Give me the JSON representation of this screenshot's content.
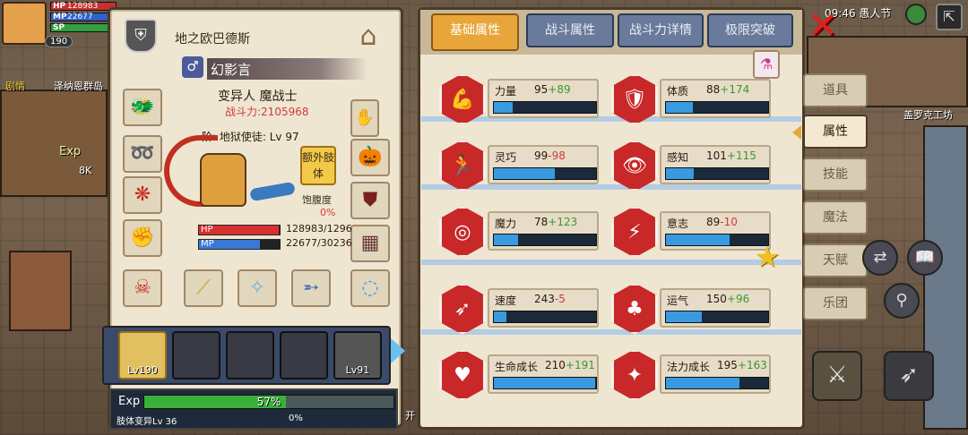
{
  "hud": {
    "hp_label": "HP",
    "hp_value": "128983",
    "mp_label": "MP",
    "mp_value": "22677",
    "sp_label": "SP",
    "level": "190",
    "avatar_icon": "hero-portrait"
  },
  "world": {
    "label_left_top": "剧情",
    "label_left_mid": "泽纳恩群岛",
    "exp_label": "Exp",
    "exp_value": "8K",
    "clock_text": "09:46 愚人节",
    "location": "盖罗克工坊",
    "side_text": "开"
  },
  "char_panel": {
    "title": "地之欧巴德斯",
    "name": "幻影言",
    "class": "变异人 魔战士",
    "power": "战斗力:2105968",
    "job": "阶: 地狱使徒: Lv 97",
    "extra_body": "额外肢体",
    "satiety_label": "饱腹度",
    "satiety_value": "0%",
    "hp_label": "HP",
    "hp_text": "128983/1296",
    "mp_label": "MP",
    "mp_text": "22677/30236",
    "hp_ratio": 0.99,
    "mp_ratio": 0.75,
    "icons": {
      "emblem": "shield-wings-icon",
      "hanger": "hanger-icon",
      "gender": "male-icon",
      "head": "dragon-helmet",
      "neck": "serpent-necklace",
      "body": "phoenix-armor",
      "hands": "demon-gauntlet",
      "belt": "demon-mask",
      "right_top": "blue-gauntlet",
      "right_2": "pumpkin-head",
      "right_3": "spiked-shield",
      "right_4": "dark-armor",
      "right_5": "blue-serpent-ring",
      "weapon1": "golden-staff",
      "weapon2": "ice-blade",
      "weapon3": "swordfish"
    }
  },
  "party": {
    "slots": [
      {
        "level": "Lv190",
        "active": true
      },
      {
        "level": "",
        "active": false
      },
      {
        "level": "",
        "active": false
      },
      {
        "level": "",
        "active": false
      },
      {
        "level": "Lv91",
        "active": false
      }
    ]
  },
  "exp": {
    "label": "Exp",
    "percent": "57%",
    "ratio": 0.57,
    "body_change": "肢体变异Lv 36",
    "body_change_pct": "0%"
  },
  "tabs": [
    {
      "label": "基础属性",
      "active": true
    },
    {
      "label": "战斗属性",
      "active": false
    },
    {
      "label": "战斗力详情",
      "active": false
    },
    {
      "label": "极限突破",
      "active": false
    }
  ],
  "side_menu": [
    {
      "label": "道具",
      "active": false
    },
    {
      "label": "属性",
      "active": true
    },
    {
      "label": "技能",
      "active": false
    },
    {
      "label": "魔法",
      "active": false
    },
    {
      "label": "天赋",
      "active": false
    },
    {
      "label": "乐团",
      "active": false
    }
  ],
  "attributes": [
    {
      "name": "力量",
      "base": "95",
      "mod": "+89",
      "sign": "bonus",
      "icon": "muscle-arm-icon",
      "glyph": "💪",
      "ratio": 0.18
    },
    {
      "name": "体质",
      "base": "88",
      "mod": "+174",
      "sign": "bonus",
      "icon": "body-armor-icon",
      "glyph": "🛡",
      "ratio": 0.26
    },
    {
      "name": "灵巧",
      "base": "99",
      "mod": "-98",
      "sign": "malus",
      "icon": "running-man-icon",
      "glyph": "🏃",
      "ratio": 0.6
    },
    {
      "name": "感知",
      "base": "101",
      "mod": "+115",
      "sign": "bonus",
      "icon": "eye-icon",
      "glyph": "👁",
      "ratio": 0.27
    },
    {
      "name": "魔力",
      "base": "78",
      "mod": "+123",
      "sign": "bonus",
      "icon": "magic-swirl-icon",
      "glyph": "◎",
      "ratio": 0.24
    },
    {
      "name": "意志",
      "base": "89",
      "mod": "-10",
      "sign": "malus",
      "icon": "will-head-icon",
      "glyph": "⚡",
      "ratio": 0.62
    },
    {
      "name": "速度",
      "base": "243",
      "mod": "-5",
      "sign": "malus",
      "icon": "wing-speed-icon",
      "glyph": "➶",
      "ratio": 0.12
    },
    {
      "name": "运气",
      "base": "150",
      "mod": "+96",
      "sign": "bonus",
      "icon": "clover-icon",
      "glyph": "♣",
      "ratio": 0.35
    },
    {
      "name": "生命成长",
      "base": "210",
      "mod": "+191",
      "sign": "bonus",
      "icon": "heart-growth-icon",
      "glyph": "♥",
      "ratio": 0.99
    },
    {
      "name": "法力成长",
      "base": "195",
      "mod": "+163",
      "sign": "bonus",
      "icon": "mana-growth-icon",
      "glyph": "✦",
      "ratio": 0.72
    }
  ],
  "extra_icons": {
    "close": "close-x-icon",
    "potion": "potion-icon",
    "star": "star-icon",
    "sword": "sword-icon",
    "bow": "bow-icon",
    "book": "book-icon",
    "swap": "swap-icon",
    "search": "magnifier-icon"
  }
}
